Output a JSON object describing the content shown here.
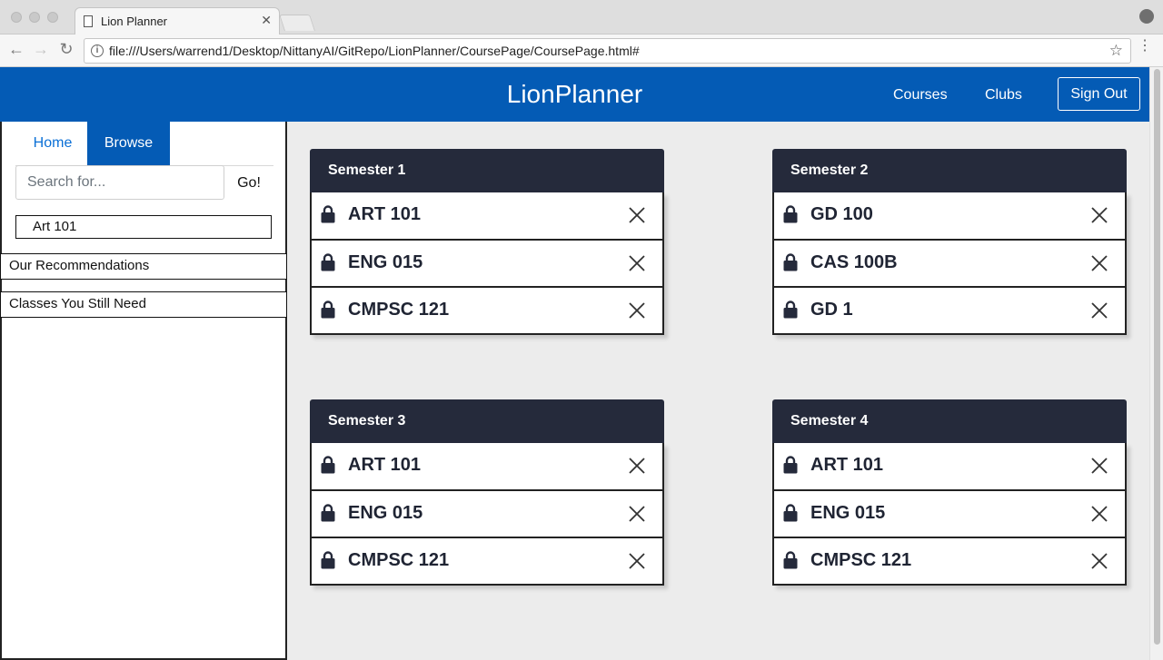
{
  "browser": {
    "tab_title": "Lion Planner",
    "url": "file:///Users/warrend1/Desktop/NittanyAI/GitRepo/LionPlanner/CoursePage/CoursePage.html#"
  },
  "header": {
    "brand": "LionPlanner",
    "nav": [
      "Courses",
      "Clubs"
    ],
    "signout_label": "Sign Out",
    "color": "#045bb5"
  },
  "sidebar": {
    "tabs": [
      "Home",
      "Browse"
    ],
    "active_tab": "Browse",
    "search": {
      "placeholder": "Search for...",
      "value": "",
      "go_label": "Go!"
    },
    "results": [
      "Art 101"
    ],
    "sections": [
      "Our Recommendations",
      "Classes You Still Need"
    ]
  },
  "semesters": [
    {
      "title": "Semester 1",
      "courses": [
        "ART 101",
        "ENG 015",
        "CMPSC 121"
      ]
    },
    {
      "title": "Semester 2",
      "courses": [
        "GD 100",
        "CAS 100B",
        "GD 1"
      ]
    },
    {
      "title": "Semester 3",
      "courses": [
        "ART 101",
        "ENG 015",
        "CMPSC 121"
      ]
    },
    {
      "title": "Semester 4",
      "courses": [
        "ART 101",
        "ENG 015",
        "CMPSC 121"
      ]
    }
  ],
  "icons": {
    "course_status": "lock-icon",
    "course_remove": "close-icon"
  }
}
